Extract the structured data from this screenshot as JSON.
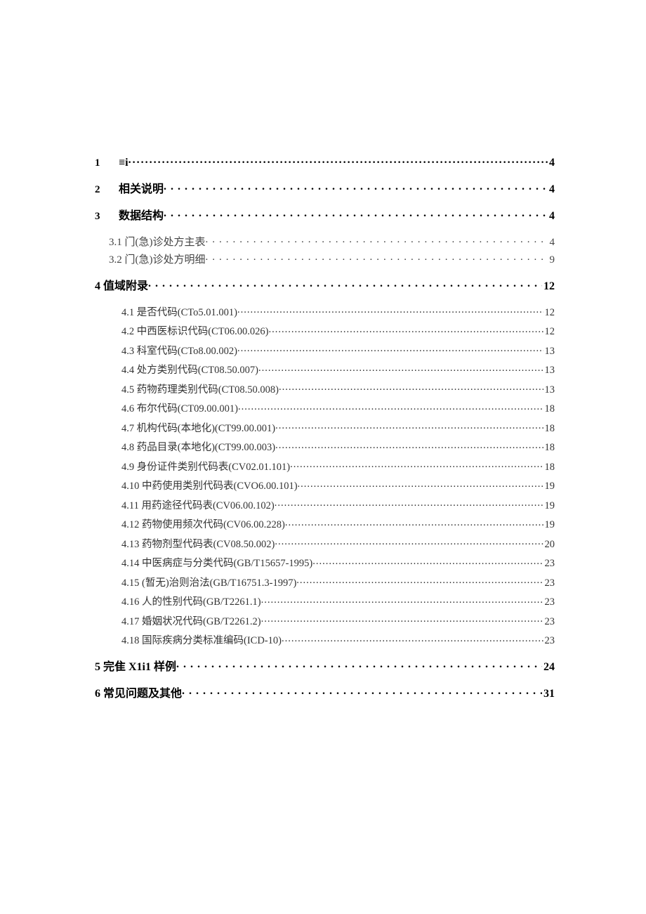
{
  "toc": {
    "s1": {
      "num": "1",
      "label": "≡i",
      "page": "4"
    },
    "s2": {
      "num": "2",
      "label": "相关说明",
      "page": "4"
    },
    "s3": {
      "num": "3",
      "label": "数据结构",
      "page": "4"
    },
    "s3_1": {
      "label": "3.1 门(急)诊处方主表",
      "page": "4"
    },
    "s3_2": {
      "label": "3.2 门(急)诊处方明细",
      "page": "9"
    },
    "s4": {
      "label": "4 值域附录",
      "page": "12"
    },
    "s4_1": {
      "label": "4.1 是否代码(CTo5.01.001)",
      "page": "12"
    },
    "s4_2": {
      "label": "4.2 中西医标识代码(CT06.00.026)",
      "page": "12"
    },
    "s4_3": {
      "label": "4.3 科室代码(CTo8.00.002)",
      "page": "13"
    },
    "s4_4": {
      "label": "4.4 处方类别代码(CT08.50.007)",
      "page": "13"
    },
    "s4_5": {
      "label": "4.5 药物药理类别代码(CT08.50.008)",
      "page": "13"
    },
    "s4_6": {
      "label": "4.6 布尔代码(CT09.00.001)",
      "page": "18"
    },
    "s4_7": {
      "label": "4.7 机构代码(本地化)(CT99.00.001)",
      "page": "18"
    },
    "s4_8": {
      "label": "4.8 药品目录(本地化)(CT99.00.003)",
      "page": "18"
    },
    "s4_9": {
      "label": "4.9 身份证件类别代码表(CV02.01.101)",
      "page": "18"
    },
    "s4_10": {
      "label": "4.10 中药使用类别代码表(CVO6.00.101)",
      "page": "19"
    },
    "s4_11": {
      "label": "4.11 用药途径代码表(CV06.00.102)",
      "page": "19"
    },
    "s4_12": {
      "label": "4.12 药物使用频次代码(CV06.00.228)",
      "page": "19"
    },
    "s4_13": {
      "label": "4.13 药物剂型代码表(CV08.50.002)",
      "page": "20"
    },
    "s4_14": {
      "label": "4.14 中医病症与分类代码(GB/T15657-1995)",
      "page": "23"
    },
    "s4_15": {
      "label": "4.15 (暂无)治则治法(GB/T16751.3-1997)",
      "page": "23"
    },
    "s4_16": {
      "label": "4.16 人的性别代码(GB/T2261.1)",
      "page": "23"
    },
    "s4_17": {
      "label": "4.17 婚姻状况代码(GB/T2261.2)",
      "page": "23"
    },
    "s4_18": {
      "label": "4.18 国际疾病分类标准编码(ICD-10)",
      "page": "23"
    },
    "s5": {
      "label": "5 完隹 X1i1 样例",
      "page": "24"
    },
    "s6": {
      "label": "6 常见问题及其他",
      "page": "31"
    }
  }
}
